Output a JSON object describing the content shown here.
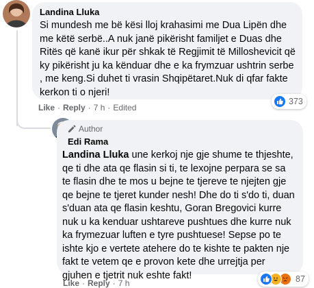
{
  "comment1": {
    "author": "Landina Lluka",
    "text": "Si mundesh me bë kësi lloj krahasimi me Dua Lipën dhe me këtë serbë..A nuk janë pikërisht familjet e Duas dhe Ritës që kanë ikur për shkak të Regjimit të Milloshevicit që ky pikërisht ju ka kënduar dhe e ka frymzuar ushtrin serbe , me keng.Si duhet ti vrasin Shqipëtaret.Nuk di qfar fakte kerkon ti o njeri!",
    "like": "Like",
    "reply": "Reply",
    "time": "7 h",
    "edited": "Edited",
    "reactions_count": "373"
  },
  "comment2": {
    "badge": "Author",
    "author": "Edi Rama",
    "mention": "Landina Lluka",
    "text": " une kerkoj nje gje shume te thjeshte, qe ti dhe ata qe flasin si ti, te lexojne perpara se sa te flasin dhe te mos u bejne te tjereve te njejten gje qe bejne te tjeret kunder nesh! Dhe do ti s'do ti, duan s'duan ata qe flasin keshtu, Goran Bregovici kurre nuk u ka kenduar ushtareve pushtues dhe kurre nuk ka frymezuar luften e tyre pushtuese! Sepse po te ishte kjo e vertete atehere do te kishte te pakten nje fakt te vetem qe e provon kete dhe urrejtja per gjuhen e tjetrit nuk eshte fakt!",
    "like": "Like",
    "reply": "Reply",
    "time": "7 h",
    "reactions_count": "87"
  },
  "colors": {
    "like_blue": "#1877f2",
    "bubble": "#f0f2f5",
    "meta": "#65676b",
    "thread": "#d9dbe0"
  },
  "icons": [
    "like-icon",
    "haha-icon",
    "angry-icon",
    "author-pen-icon"
  ]
}
